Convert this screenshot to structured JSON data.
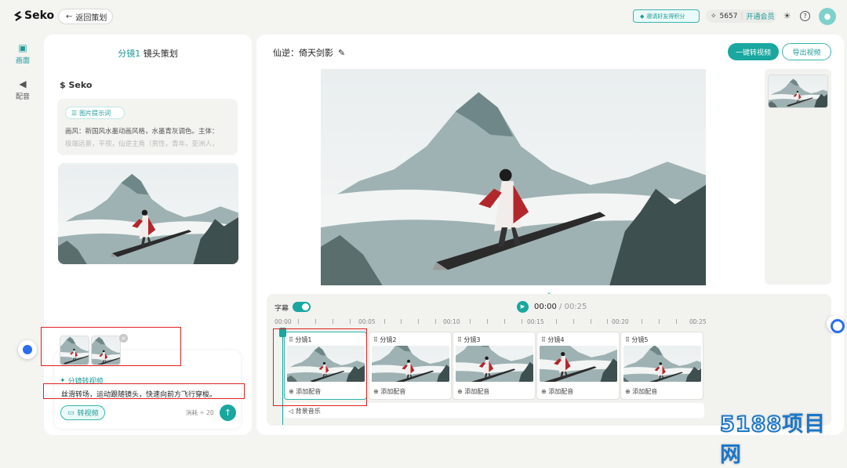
{
  "app": {
    "name": "Seko"
  },
  "header": {
    "back_label": "返回策划",
    "invite_label": "邀请好友得积分",
    "credits": "5657",
    "vip_label": "开通会员"
  },
  "rail": {
    "items": [
      {
        "label": "画面",
        "active": true
      },
      {
        "label": "配音",
        "active": false
      }
    ]
  },
  "left_panel": {
    "shot_label": "分镜1",
    "title": "镜头策划",
    "brand": "Seko",
    "prompt_chip": "图片提示词",
    "prompt_line1": "画风：新国风水墨动画风格，水墨青灰调色。主体：",
    "prompt_line2": "极端远景，平视，仙逆主角（男性，青年，亚洲人，",
    "ai_label": "分镜转视频",
    "ai_text": "丝滑转场，运动跟随镜头，快速向前方飞行穿梭。",
    "convert_label": "转视频",
    "cost_label": "消耗",
    "cost_value": "20"
  },
  "editor": {
    "project_title": "仙逆：倚天剑影",
    "one_click_label": "一键转视频",
    "export_label": "导出视频",
    "subtitle_label": "字幕",
    "subtitle_on": true,
    "current_time": "00:00",
    "total_time": "00:25",
    "ruler_labels": [
      "00:00",
      "00:05",
      "00:10",
      "00:15",
      "00:20",
      "00:25"
    ],
    "clips": [
      {
        "name": "分镜1",
        "audio": "添加配音",
        "selected": true
      },
      {
        "name": "分镜2",
        "audio": "添加配音",
        "selected": false
      },
      {
        "name": "分镜3",
        "audio": "添加配音",
        "selected": false
      },
      {
        "name": "分镜4",
        "audio": "添加配音",
        "selected": false
      },
      {
        "name": "分镜5",
        "audio": "添加配音",
        "selected": false
      }
    ],
    "bgm_label": "背景音乐"
  },
  "watermark": {
    "a": "5188",
    "b": "项目网"
  },
  "colors": {
    "accent": "#19a79f",
    "highlight": "#e02020",
    "background": "#f4f4f1"
  }
}
